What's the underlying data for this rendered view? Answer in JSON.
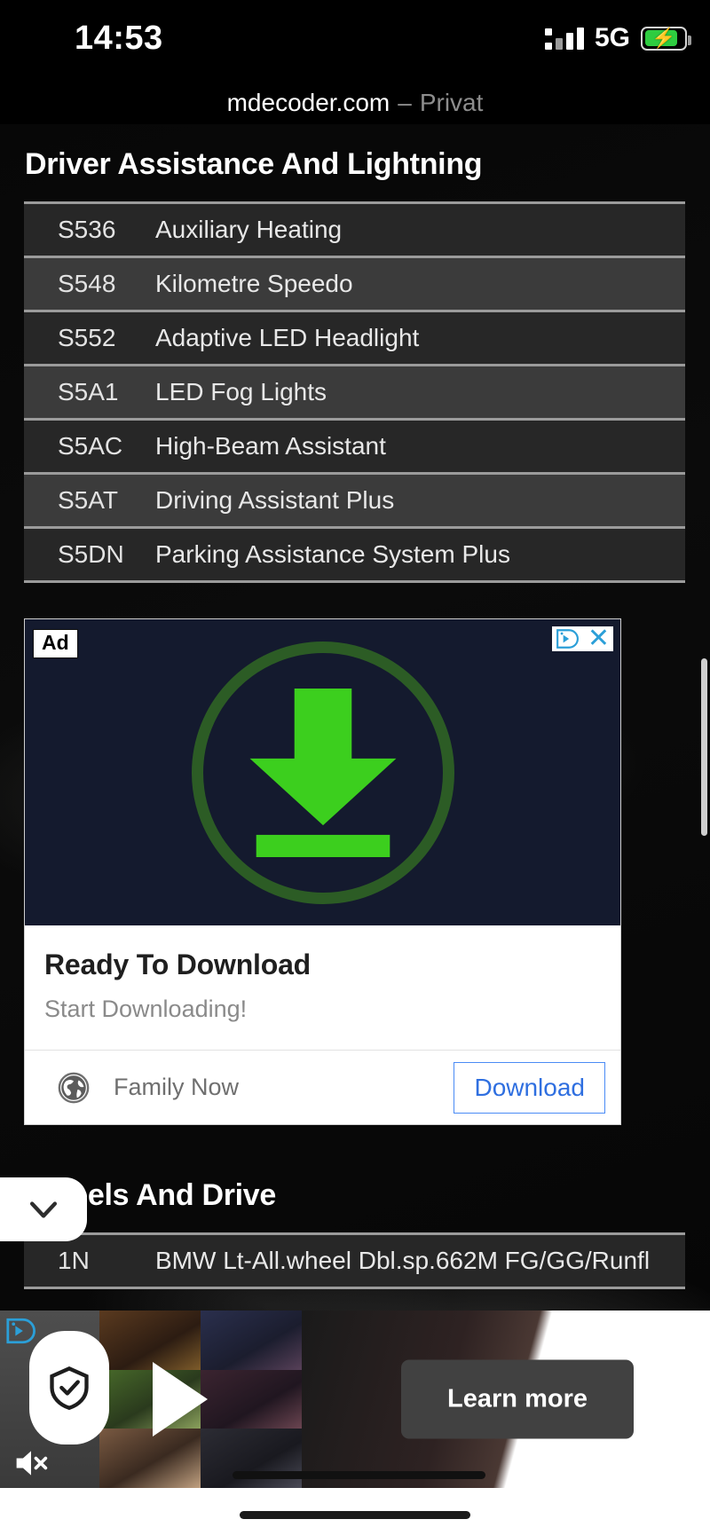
{
  "status_bar": {
    "time": "14:53",
    "network": "5G",
    "signal_icon": "signal-bars-icon",
    "battery_icon": "battery-charging-icon"
  },
  "browser": {
    "domain": "mdecoder.com",
    "mode_separator": "–",
    "mode": "Privat"
  },
  "sections": [
    {
      "title": "Driver Assistance And Lightning",
      "rows": [
        {
          "code": "S536",
          "name": "Auxiliary Heating"
        },
        {
          "code": "S548",
          "name": "Kilometre Speedo"
        },
        {
          "code": "S552",
          "name": "Adaptive LED Headlight"
        },
        {
          "code": "S5A1",
          "name": "LED Fog Lights"
        },
        {
          "code": "S5AC",
          "name": "High-Beam Assistant"
        },
        {
          "code": "S5AT",
          "name": "Driving Assistant Plus"
        },
        {
          "code": "S5DN",
          "name": "Parking Assistance System Plus"
        }
      ]
    },
    {
      "title": "Wheels And Drive",
      "rows": [
        {
          "code": "1N",
          "name": "BMW Lt-All.wheel Dbl.sp.662M FG/GG/Runfl"
        }
      ]
    }
  ],
  "display_ad": {
    "badge": "Ad",
    "adchoices_icon": "adchoices-icon",
    "close_icon": "close-x-icon",
    "creative_icon": "download-arrow-icon",
    "headline": "Ready To Download",
    "subtext": "Start Downloading!",
    "advertiser_icon": "globe-icon",
    "advertiser": "Family Now",
    "cta_label": "Download",
    "colors": {
      "creative_bg": "#141a2e",
      "arrow_green": "#3ccf1e",
      "ring_green": "#2c5c25",
      "cta_blue": "#2f6fe0"
    }
  },
  "collapse_control": {
    "icon": "chevron-down-icon"
  },
  "sticky_video_ad": {
    "adchoices_icon": "adchoices-icon",
    "play_icon": "play-icon",
    "mute_icon": "volume-muted-icon",
    "shield_icon": "shield-check-icon",
    "cta_label": "Learn more",
    "cta_color": "#414141"
  },
  "system": {
    "home_indicator": "home-indicator"
  }
}
